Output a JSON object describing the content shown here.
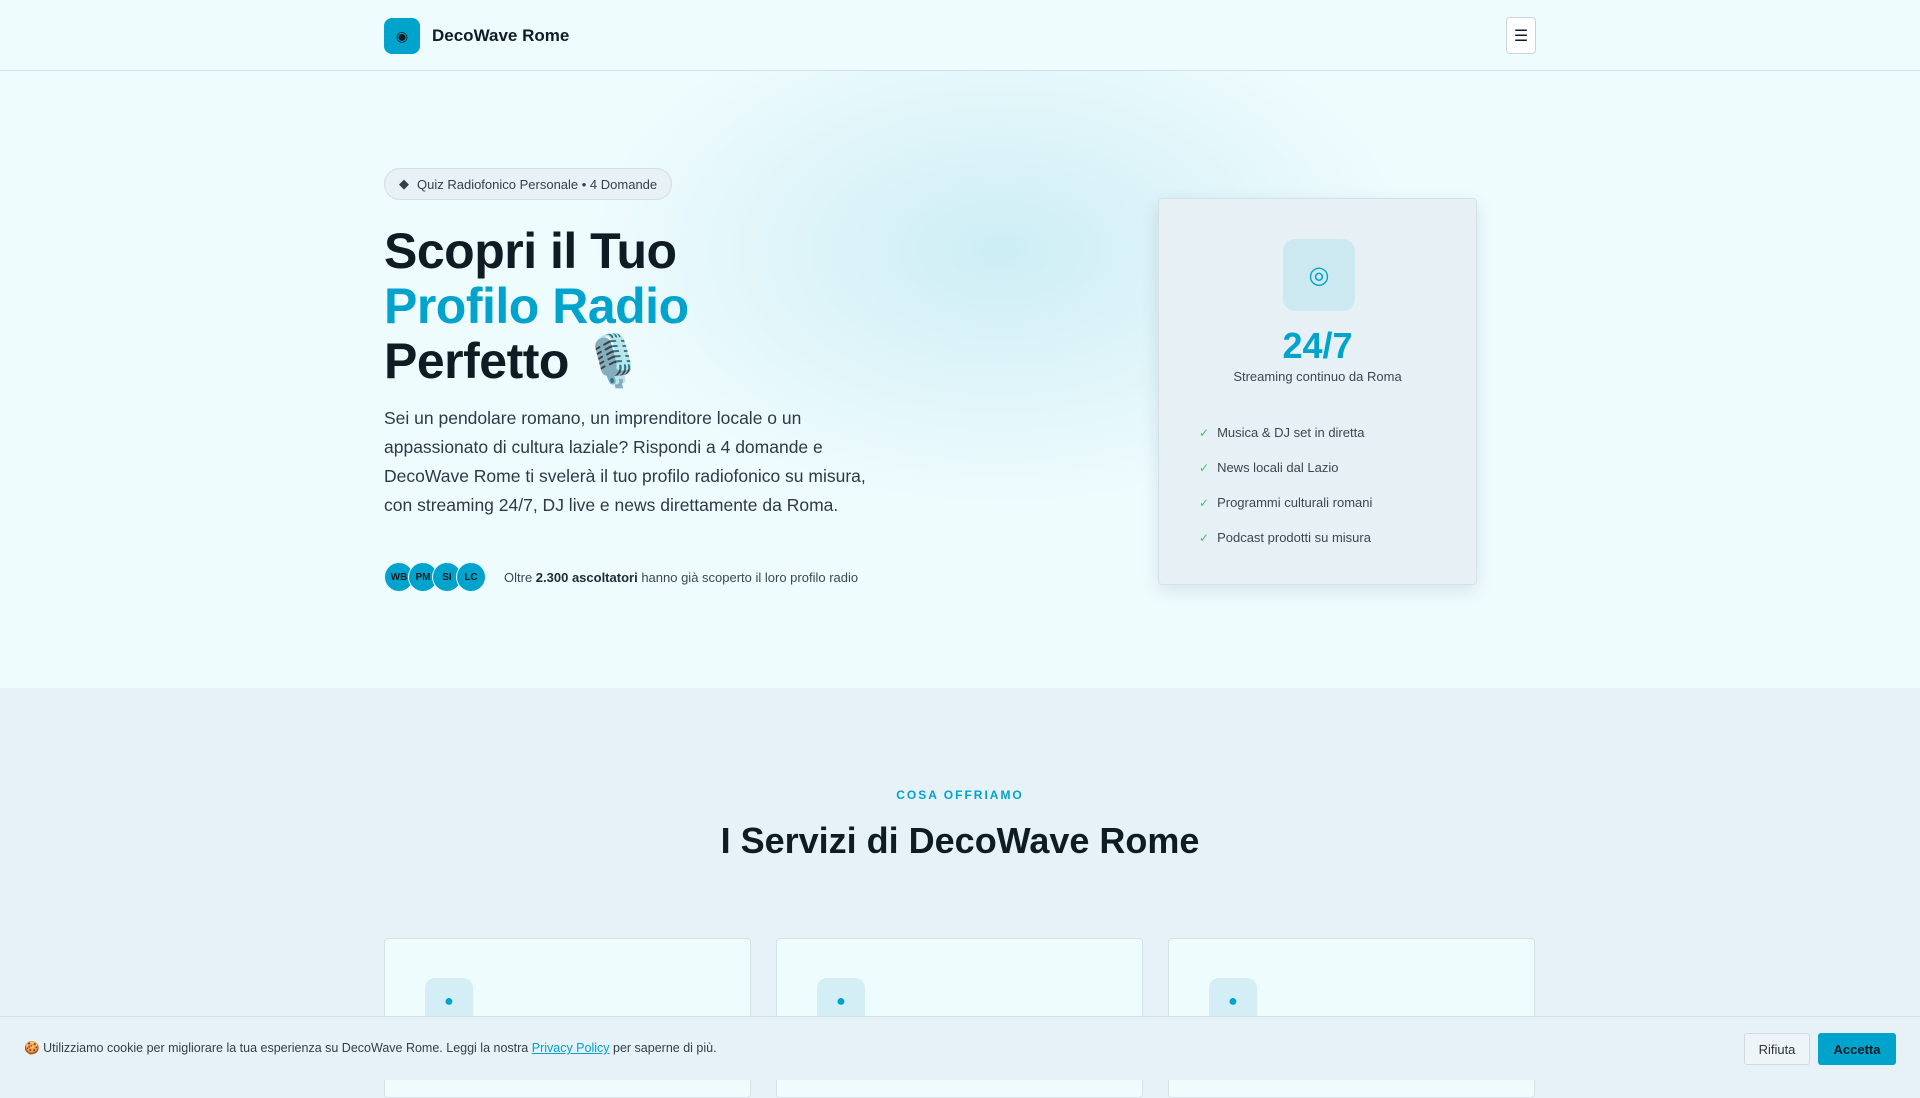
{
  "header": {
    "brand": "DecoWave Rome",
    "logo_icon": "radio-icon",
    "menu_icon": "menu-icon"
  },
  "hero": {
    "badge": "Quiz Radiofonico Personale • 4 Domande",
    "title_line1": "Scopri il Tuo",
    "title_line2": "Profilo Radio",
    "title_line3": "Perfetto",
    "title_emoji": "🎙️",
    "lead": "Sei un pendolare romano, un imprenditore locale o un appassionato di cultura laziale? Rispondi a 4 domande e DecoWave Rome ti svelerà il tuo profilo radiofonico su misura, con streaming 24/7, DJ live e news direttamente da Roma.",
    "avatars": [
      "WB",
      "PM",
      "SI",
      "LC"
    ],
    "social_prefix": "Oltre",
    "social_bold": "2.300 ascoltatori",
    "social_suffix": "hanno già scoperto il loro profilo radio"
  },
  "card": {
    "stat": "24/7",
    "stat_label": "Streaming continuo da Roma",
    "features": [
      "Musica & DJ set in diretta",
      "News locali dal Lazio",
      "Programmi culturali romani",
      "Podcast prodotti su misura"
    ]
  },
  "services": {
    "eyebrow": "COSA OFFRIAMO",
    "title": "I Servizi di DecoWave Rome"
  },
  "cookie": {
    "emoji": "🍪",
    "text": "Utilizziamo cookie per migliorare la tua esperienza su DecoWave Rome. Leggi la nostra",
    "link": "Privacy Policy",
    "text_after": "per saperne di più.",
    "reject": "Rifiuta",
    "accept": "Accetta"
  },
  "colors": {
    "accent": "#00a3cc",
    "check": "#3cc46a"
  }
}
